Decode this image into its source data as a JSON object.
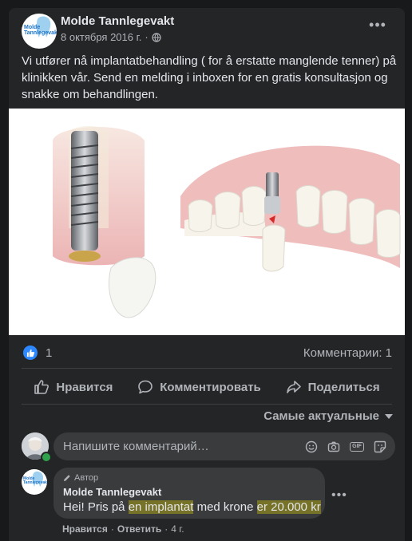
{
  "post": {
    "page_name": "Molde Tannlegevakt",
    "logo_text": "Molde Tannlegevakt",
    "date": "8 октября 2016 г.",
    "separator": "·",
    "text": "Vi utfører nå implantatbehandling ( for å erstatte manglende tenner) på klinikken vår. Send en melding i inboxen for en gratis konsultasjon og snakke om behandlingen.",
    "like_count": "1",
    "comment_count": "Комментарии: 1"
  },
  "actions": {
    "like": "Нравится",
    "comment": "Комментировать",
    "share": "Поделиться"
  },
  "sort_label": "Самые актуальные",
  "comment_box": {
    "placeholder": "Напишите комментарий…",
    "gif_label": "GIF"
  },
  "comment": {
    "author_tag": "Автор",
    "name": "Molde Tannlegevakt",
    "text_parts": [
      "Hei! Pris på ",
      "en implantat",
      " med krone ",
      "er 20.000 kr"
    ],
    "like": "Нравится",
    "reply": "Ответить",
    "time": "4 г.",
    "dot": "·"
  },
  "colors": {
    "card_bg": "#242526",
    "accent": "#2d88ff",
    "text_primary": "#e4e6eb",
    "text_secondary": "#b0b3b8",
    "highlight": "#e9d900"
  }
}
